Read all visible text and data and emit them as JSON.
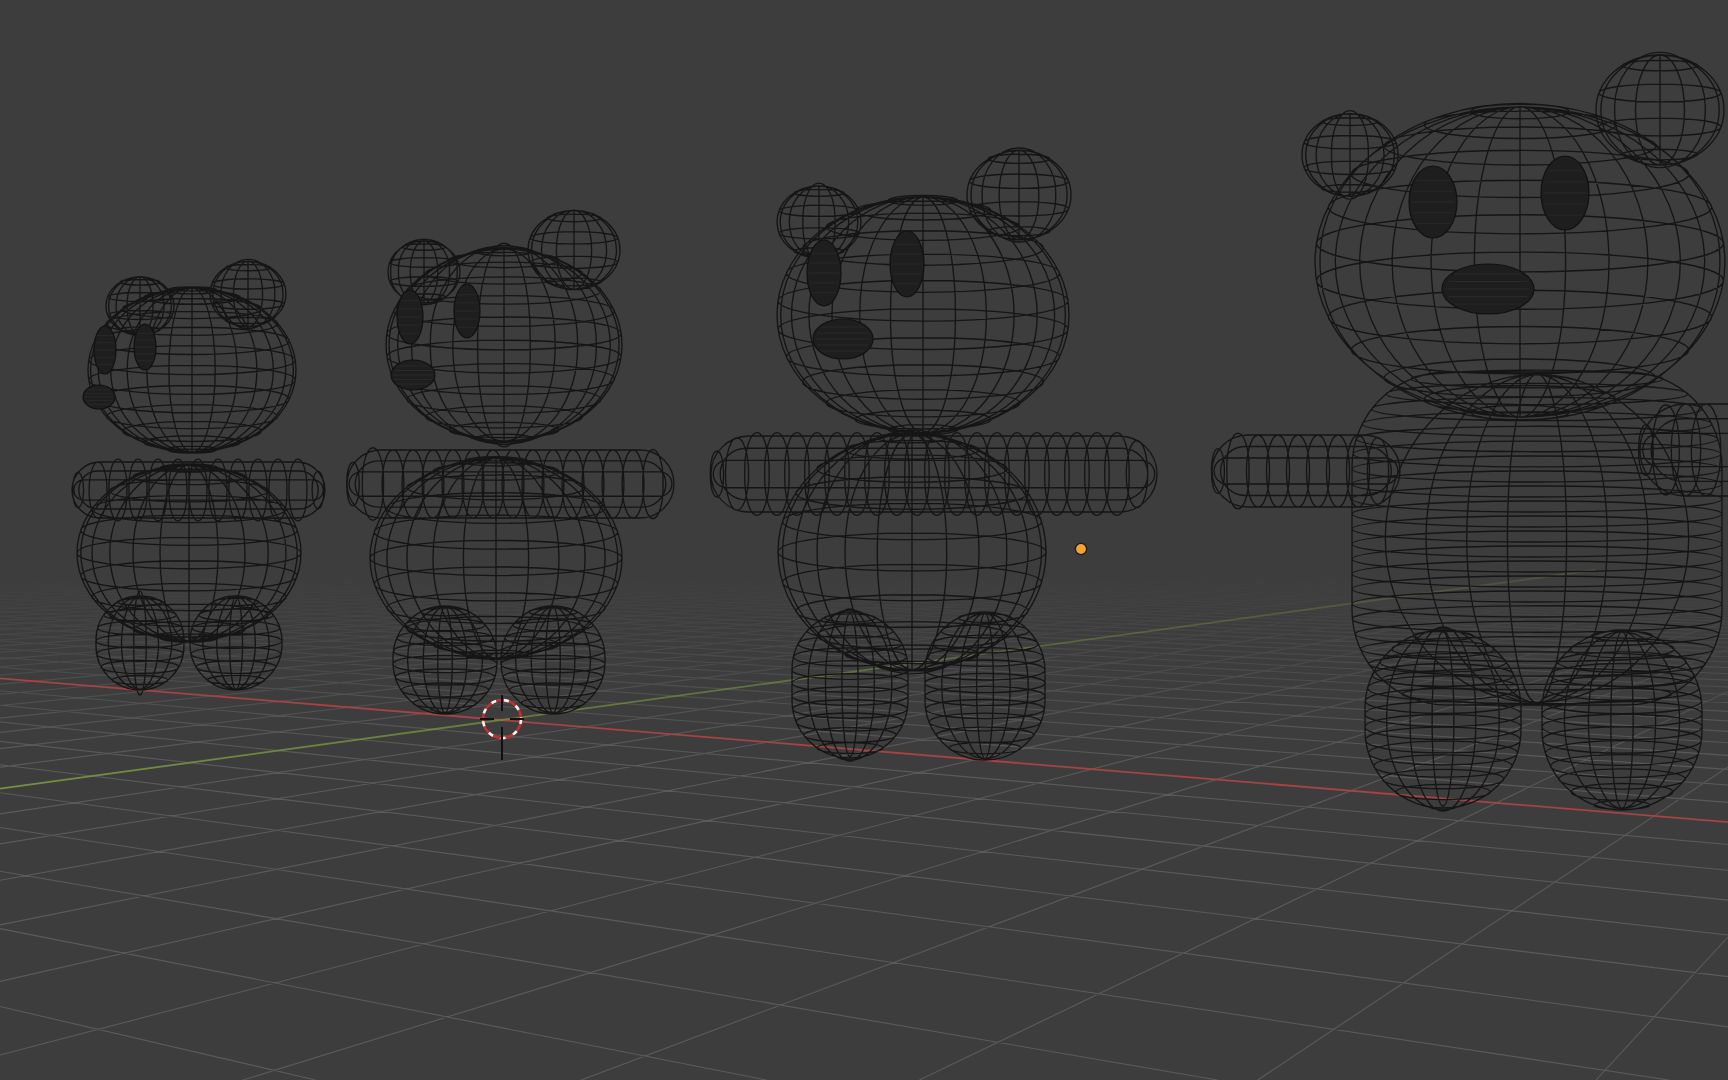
{
  "viewport": {
    "floor": {
      "axes": [
        {
          "kind": "x"
        },
        {
          "kind": "y"
        }
      ]
    },
    "models": [
      {
        "kind": "bear"
      },
      {
        "kind": "bear"
      },
      {
        "kind": "bear"
      },
      {
        "kind": "bear"
      }
    ],
    "markers": [
      {
        "kind": "cursor"
      },
      {
        "kind": "point"
      }
    ]
  }
}
